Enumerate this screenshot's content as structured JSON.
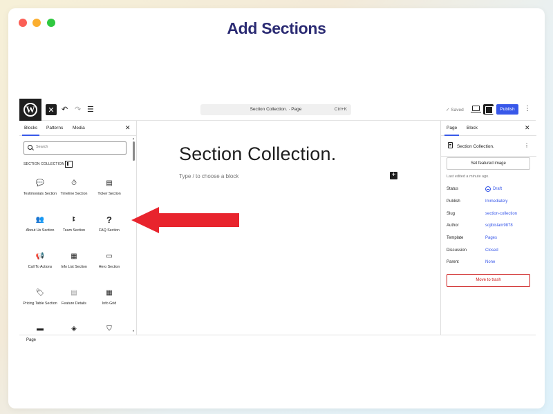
{
  "headline": "Add Sections",
  "topbar": {
    "close_label": "✕",
    "doc_title": "Section Collection. · Page",
    "shortcut": "Ctrl+K",
    "saved": "✓ Saved",
    "publish": "Publish"
  },
  "inserter": {
    "tabs": [
      "Blocks",
      "Patterns",
      "Media"
    ],
    "active_tab": "Blocks",
    "search_placeholder": "Search",
    "category": "SECTION COLLECTION",
    "blocks": [
      {
        "label": "Testimonials Section",
        "icon": "speech-bubble-icon"
      },
      {
        "label": "Timeline Section",
        "icon": "timeline-icon"
      },
      {
        "label": "Ticker Section",
        "icon": "ticker-icon"
      },
      {
        "label": "About Us Section",
        "icon": "people-icon"
      },
      {
        "label": "Team Section",
        "icon": "team-icon"
      },
      {
        "label": "FAQ Section",
        "icon": "question-icon"
      },
      {
        "label": "Call To Actions",
        "icon": "megaphone-icon"
      },
      {
        "label": "Info List Section",
        "icon": "info-list-icon"
      },
      {
        "label": "Hero Section",
        "icon": "hero-icon"
      },
      {
        "label": "Pricing Table Section",
        "icon": "price-tag-icon"
      },
      {
        "label": "Feature Details",
        "icon": "feature-details-icon"
      },
      {
        "label": "Info Grid",
        "icon": "grid-icon"
      },
      {
        "label": "",
        "icon": "card-icon"
      },
      {
        "label": "",
        "icon": "layers-icon"
      },
      {
        "label": "",
        "icon": "shield-icon"
      }
    ]
  },
  "canvas": {
    "title": "Section Collection.",
    "placeholder": "Type / to choose a block"
  },
  "settings": {
    "tabs": [
      "Page",
      "Block"
    ],
    "active_tab": "Page",
    "doc_name": "Section Collection.",
    "featured_image": "Set featured image",
    "last_edited": "Last edited a minute ago.",
    "meta": [
      {
        "key": "Status",
        "value": "Draft"
      },
      {
        "key": "Publish",
        "value": "Immediately"
      },
      {
        "key": "Slug",
        "value": "section-collection"
      },
      {
        "key": "Author",
        "value": "sojibislam9878"
      },
      {
        "key": "Template",
        "value": "Pages"
      },
      {
        "key": "Discussion",
        "value": "Closed"
      },
      {
        "key": "Parent",
        "value": "None"
      }
    ],
    "trash": "Move to trash"
  },
  "footer": {
    "breadcrumb": "Page"
  },
  "colors": {
    "accent": "#3858e9",
    "arrow": "#e8242d",
    "danger": "#cc1818",
    "headline": "#2b2b73"
  }
}
